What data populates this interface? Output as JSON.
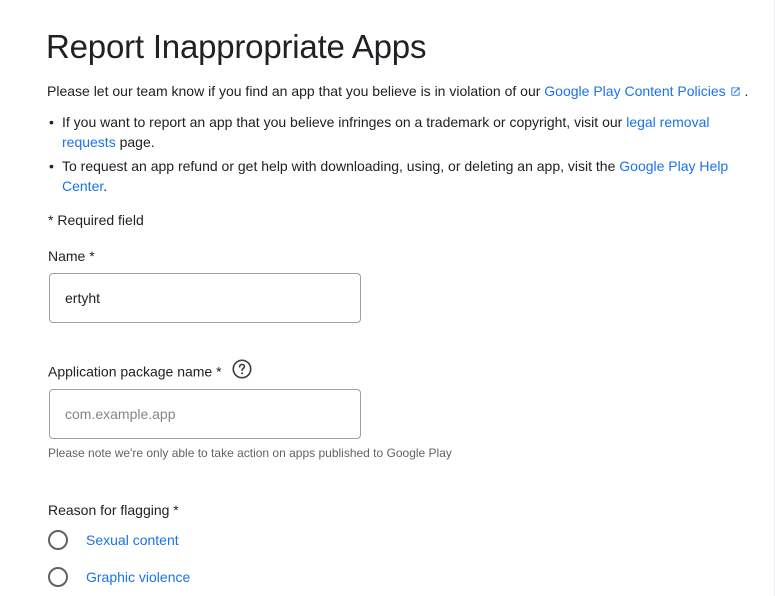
{
  "header": {
    "title": "Report Inappropriate Apps"
  },
  "intro": {
    "text": "Please let our team know if you find an app that you believe is in violation of our ",
    "policy_link": "Google Play Content Policies",
    "suffix": " ."
  },
  "bullets": [
    {
      "before": "If you want to report an app that you believe infringes on a trademark or copyright, visit our ",
      "link": "legal removal requests",
      "after": " page."
    },
    {
      "before": "To request an app refund or get help with downloading, using, or deleting an app, visit the ",
      "link": "Google Play Help Center",
      "after": "."
    }
  ],
  "required_note": "* Required field",
  "form": {
    "name": {
      "label": "Name *",
      "value": "ertyht"
    },
    "package": {
      "label": "Application package name *",
      "placeholder": "com.example.app",
      "value": "",
      "hint": "Please note we're only able to take action on apps published to Google Play",
      "help_icon": "help-circle-icon"
    },
    "reason": {
      "label": "Reason for flagging *",
      "options": [
        {
          "label": "Sexual content"
        },
        {
          "label": "Graphic violence"
        }
      ]
    }
  },
  "colors": {
    "link": "#1a73e8",
    "text": "#202124",
    "border": "#9aa0a6",
    "hint": "#5f6368"
  }
}
